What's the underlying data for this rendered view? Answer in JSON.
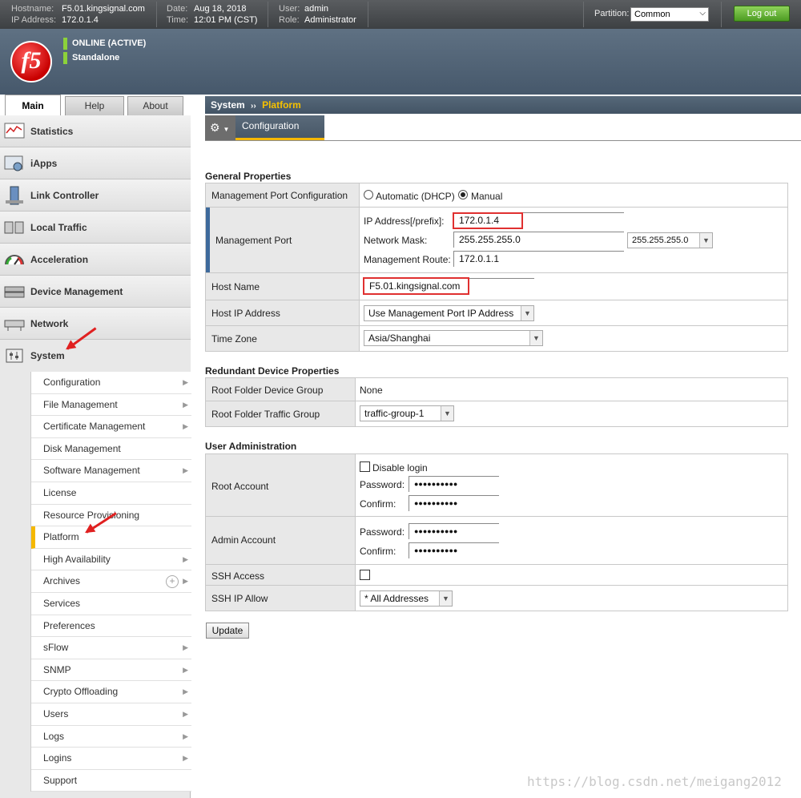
{
  "topbar": {
    "hostname_key": "Hostname:",
    "hostname": "F5.01.kingsignal.com",
    "ip_key": "IP Address:",
    "ip": "172.0.1.4",
    "date_key": "Date:",
    "date": "Aug 18, 2018",
    "time_key": "Time:",
    "time": "12:01 PM (CST)",
    "user_key": "User:",
    "user": "admin",
    "role_key": "Role:",
    "role": "Administrator",
    "partition_label": "Partition:",
    "partition_value": "Common",
    "logout_label": "Log out"
  },
  "header": {
    "logo_text": "f5",
    "status": "ONLINE (ACTIVE)",
    "mode": "Standalone",
    "status_color": "#8cd23a"
  },
  "tabs": [
    "Main",
    "Help",
    "About"
  ],
  "nav": {
    "items": [
      "Statistics",
      "iApps",
      "Link Controller",
      "Local Traffic",
      "Acceleration",
      "Device Management",
      "Network",
      "System"
    ],
    "submenu": [
      "Configuration",
      "File Management",
      "Certificate Management",
      "Disk Management",
      "Software Management",
      "License",
      "Resource Provisioning",
      "Platform",
      "High Availability",
      "Archives",
      "Services",
      "Preferences",
      "sFlow",
      "SNMP",
      "Crypto Offloading",
      "Users",
      "Logs",
      "Logins",
      "Support"
    ]
  },
  "breadcrumb": {
    "section": "System",
    "sep": "››",
    "current": "Platform"
  },
  "subtabs": {
    "gear": "⚙",
    "configuration": "Configuration"
  },
  "general": {
    "title": "General Properties",
    "mgmt_port_config_label": "Management Port Configuration",
    "opt_dhcp": "Automatic (DHCP)",
    "opt_manual": "Manual",
    "mgmt_port_label": "Management Port",
    "ip_label": "IP Address[/prefix]:",
    "ip_value": "172.0.1.4",
    "mask_label": "Network Mask:",
    "mask_value": "255.255.255.0",
    "mask_select": "255.255.255.0",
    "route_label": "Management Route:",
    "route_value": "172.0.1.1",
    "host_name_label": "Host Name",
    "host_name_value": "F5.01.kingsignal.com",
    "host_ip_label": "Host IP Address",
    "host_ip_value": "Use Management Port IP Address",
    "tz_label": "Time Zone",
    "tz_value": "Asia/Shanghai"
  },
  "redundant": {
    "title": "Redundant Device Properties",
    "root_dg_label": "Root Folder Device Group",
    "root_dg_value": "None",
    "root_tg_label": "Root Folder Traffic Group",
    "root_tg_value": "traffic-group-1"
  },
  "useradmin": {
    "title": "User Administration",
    "root_label": "Root Account",
    "disable_login": "Disable login",
    "password_label": "Password:",
    "confirm_label": "Confirm:",
    "masked": "●●●●●●●●●●",
    "admin_label": "Admin Account",
    "ssh_access_label": "SSH Access",
    "ssh_allow_label": "SSH IP Allow",
    "ssh_allow_value": "* All Addresses"
  },
  "update_label": "Update",
  "watermark": "https://blog.csdn.net/meigang2012",
  "colors": {
    "accent": "#f5b800",
    "header": "#4f6174",
    "logout": "#5aa82a"
  }
}
